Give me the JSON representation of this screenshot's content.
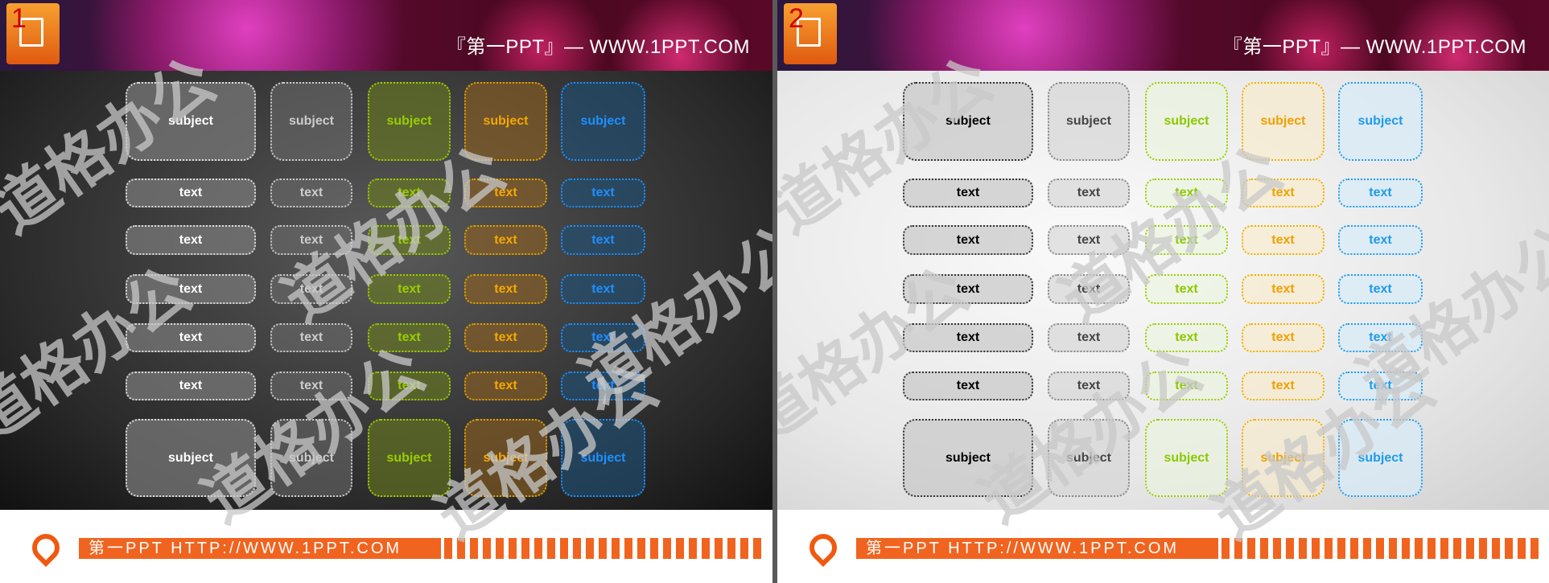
{
  "slides": [
    {
      "number": "1",
      "header_title": "『第一PPT』— WWW.1PPT.COM",
      "footer_text": "第一PPT HTTP://WWW.1PPT.COM",
      "theme": "dark",
      "columns": [
        {
          "text_color": "#ffffff",
          "bg": "rgba(120,120,120,0.75)",
          "border": "#dddddd"
        },
        {
          "text_color": "#cccccc",
          "bg": "rgba(110,110,110,0.55)",
          "border": "#cccccc"
        },
        {
          "text_color": "#9acd00",
          "bg": "rgba(110,130,30,0.55)",
          "border": "#9acd00"
        },
        {
          "text_color": "#f5a800",
          "bg": "rgba(150,100,30,0.55)",
          "border": "#e0a000"
        },
        {
          "text_color": "#1e90ff",
          "bg": "rgba(30,80,120,0.6)",
          "border": "#1e90ff"
        }
      ]
    },
    {
      "number": "2",
      "header_title": "『第一PPT』— WWW.1PPT.COM",
      "footer_text": "第一PPT HTTP://WWW.1PPT.COM",
      "theme": "light",
      "columns": [
        {
          "text_color": "#000000",
          "bg": "rgba(200,200,200,0.7)",
          "border": "#333333"
        },
        {
          "text_color": "#444444",
          "bg": "rgba(210,210,210,0.6)",
          "border": "#888888"
        },
        {
          "text_color": "#8cc800",
          "bg": "rgba(235,245,220,0.6)",
          "border": "#9acd00"
        },
        {
          "text_color": "#f0a000",
          "bg": "rgba(250,235,200,0.6)",
          "border": "#f0b000"
        },
        {
          "text_color": "#1e9be8",
          "bg": "rgba(215,235,250,0.7)",
          "border": "#1e9be8"
        }
      ]
    }
  ],
  "rows": [
    "subject",
    "text",
    "text",
    "text",
    "text",
    "text",
    "subject"
  ],
  "watermark": "道格办公"
}
